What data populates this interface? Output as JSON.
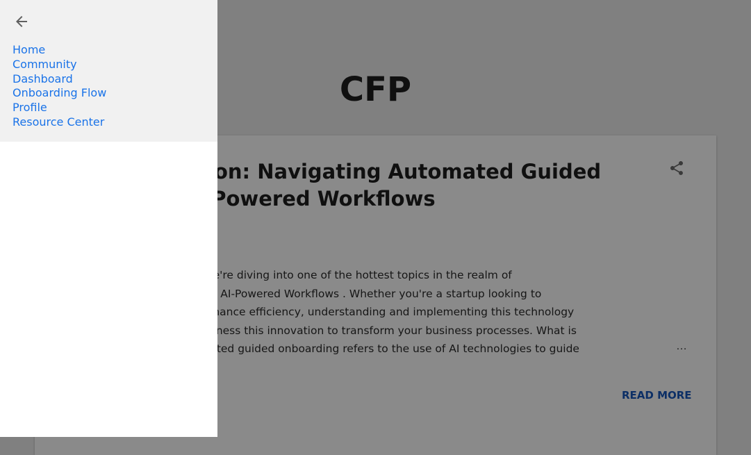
{
  "blog": {
    "title": "CFP"
  },
  "post": {
    "title_lines": [
      "Seamless Integration: Navigating Automated Guided",
      "Onboarding for AI-Powered Workflows"
    ],
    "snippet_lines": [
      "Hello there, workflow wizards! Today, we're diving into one of the hottest topics in the realm of",
      "tech: Automated Guided Onboarding for AI-Powered Workflows . Whether you're a startup looking to",
      "scale or a large enterprise aiming to enhance efficiency, understanding and implementing this technology",
      "is crucial. Let's explore how you can harness this innovation to transform your business processes. What is",
      "Guided Onboarding? At its core, automated guided onboarding refers to the use of AI technologies to guide"
    ],
    "ellipsis": "…",
    "read_more": "READ MORE",
    "share_icon": "share-icon"
  },
  "sidebar": {
    "back_icon": "arrow-back-icon",
    "items": [
      {
        "label": "Home"
      },
      {
        "label": "Community"
      },
      {
        "label": "Dashboard"
      },
      {
        "label": "Onboarding Flow"
      },
      {
        "label": "Profile"
      },
      {
        "label": "Resource Center"
      }
    ]
  },
  "colors": {
    "overlay": "#808080",
    "link": "#1a73e8",
    "read_more": "#0c2f66",
    "sidebar_header": "#f1f1f1"
  }
}
